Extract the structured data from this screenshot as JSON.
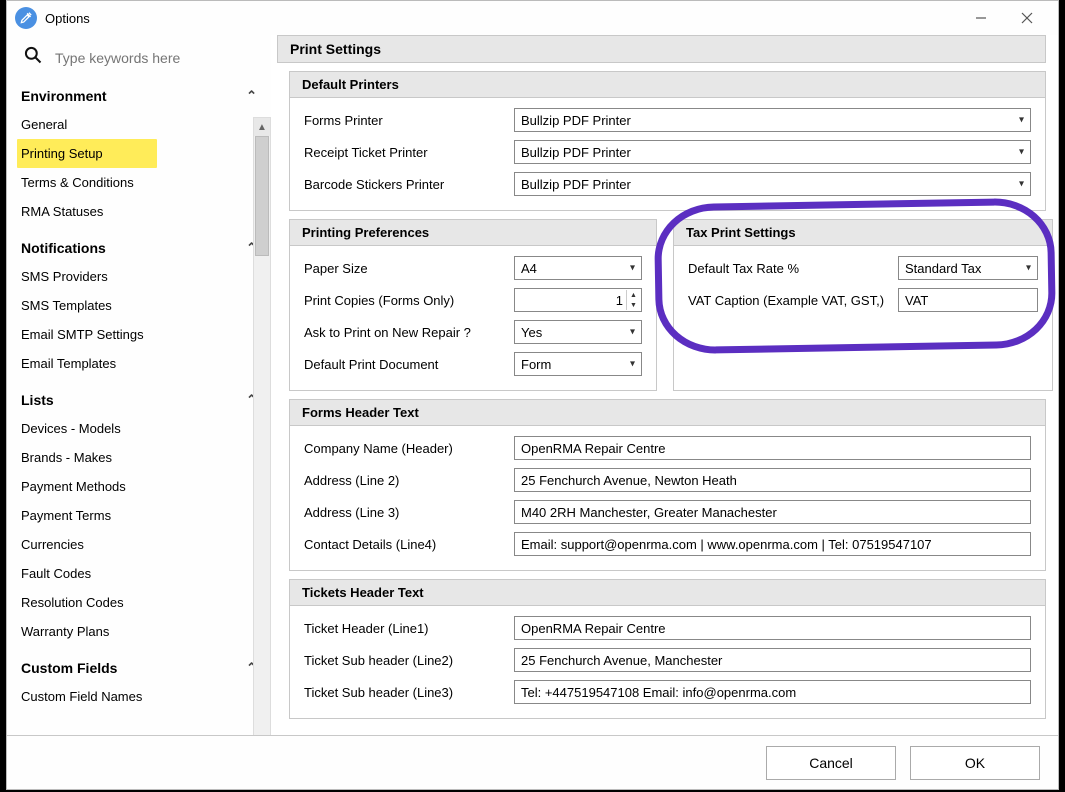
{
  "window": {
    "title": "Options"
  },
  "search": {
    "placeholder": "Type keywords here"
  },
  "nav": {
    "groups": [
      {
        "key": "env",
        "title": "Environment",
        "items": [
          "General",
          "Printing Setup",
          "Terms & Conditions",
          "RMA Statuses"
        ]
      },
      {
        "key": "notif",
        "title": "Notifications",
        "items": [
          "SMS Providers",
          "SMS Templates",
          "Email SMTP Settings",
          "Email Templates"
        ]
      },
      {
        "key": "lists",
        "title": "Lists",
        "items": [
          "Devices - Models",
          "Brands - Makes",
          "Payment Methods",
          "Payment Terms",
          "Currencies",
          "Fault Codes",
          "Resolution Codes",
          "Warranty Plans"
        ]
      },
      {
        "key": "custom",
        "title": "Custom Fields",
        "items": [
          "Custom Field Names"
        ]
      }
    ],
    "highlighted_item": "Printing Setup"
  },
  "page": {
    "title": "Print Settings"
  },
  "default_printers": {
    "heading": "Default Printers",
    "forms_printer": {
      "label": "Forms Printer",
      "value": "Bullzip PDF Printer"
    },
    "receipt_printer": {
      "label": "Receipt Ticket Printer",
      "value": "Bullzip PDF Printer"
    },
    "barcode_printer": {
      "label": "Barcode Stickers Printer",
      "value": "Bullzip PDF Printer"
    }
  },
  "printing_prefs": {
    "heading": "Printing Preferences",
    "paper_size": {
      "label": "Paper Size",
      "value": "A4"
    },
    "print_copies": {
      "label": "Print Copies (Forms Only)",
      "value": "1"
    },
    "ask_new_repair": {
      "label": "Ask to Print on New Repair ?",
      "value": "Yes"
    },
    "default_doc": {
      "label": "Default Print Document",
      "value": "Form"
    }
  },
  "tax_print": {
    "heading": "Tax Print Settings",
    "default_rate": {
      "label": "Default Tax Rate %",
      "value": "Standard Tax"
    },
    "vat_caption": {
      "label": "VAT Caption (Example VAT, GST,)",
      "value": "VAT"
    }
  },
  "forms_header": {
    "heading": "Forms Header Text",
    "company": {
      "label": "Company Name (Header)",
      "value": "OpenRMA Repair Centre"
    },
    "addr2": {
      "label": "Address (Line 2)",
      "value": "25 Fenchurch Avenue, Newton Heath"
    },
    "addr3": {
      "label": "Address (Line 3)",
      "value": "M40 2RH Manchester, Greater Manachester"
    },
    "contact": {
      "label": "Contact Details (Line4)",
      "value": "Email: support@openrma.com | www.openrma.com | Tel: 07519547107"
    }
  },
  "tickets_header": {
    "heading": "Tickets Header Text",
    "line1": {
      "label": "Ticket Header (Line1)",
      "value": "OpenRMA Repair Centre"
    },
    "line2": {
      "label": "Ticket Sub header (Line2)",
      "value": "25 Fenchurch Avenue, Manchester"
    },
    "line3": {
      "label": "Ticket Sub header (Line3)",
      "value": "Tel: +447519547108 Email: info@openrma.com"
    }
  },
  "footer": {
    "cancel": "Cancel",
    "ok": "OK"
  }
}
